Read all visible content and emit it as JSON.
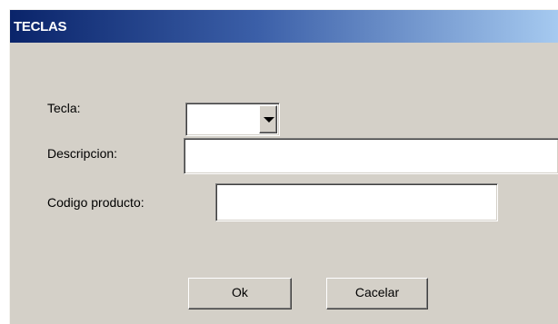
{
  "dialog": {
    "title": "TECLAS"
  },
  "form": {
    "tecla_label": "Tecla:",
    "tecla_value": "",
    "descripcion_label": "Descripcion:",
    "descripcion_value": "",
    "codigo_label": "Codigo producto:",
    "codigo_value": ""
  },
  "buttons": {
    "ok_label": "Ok",
    "cancel_label": "Cacelar"
  },
  "icons": {
    "dropdown": "chevron-down-icon"
  }
}
